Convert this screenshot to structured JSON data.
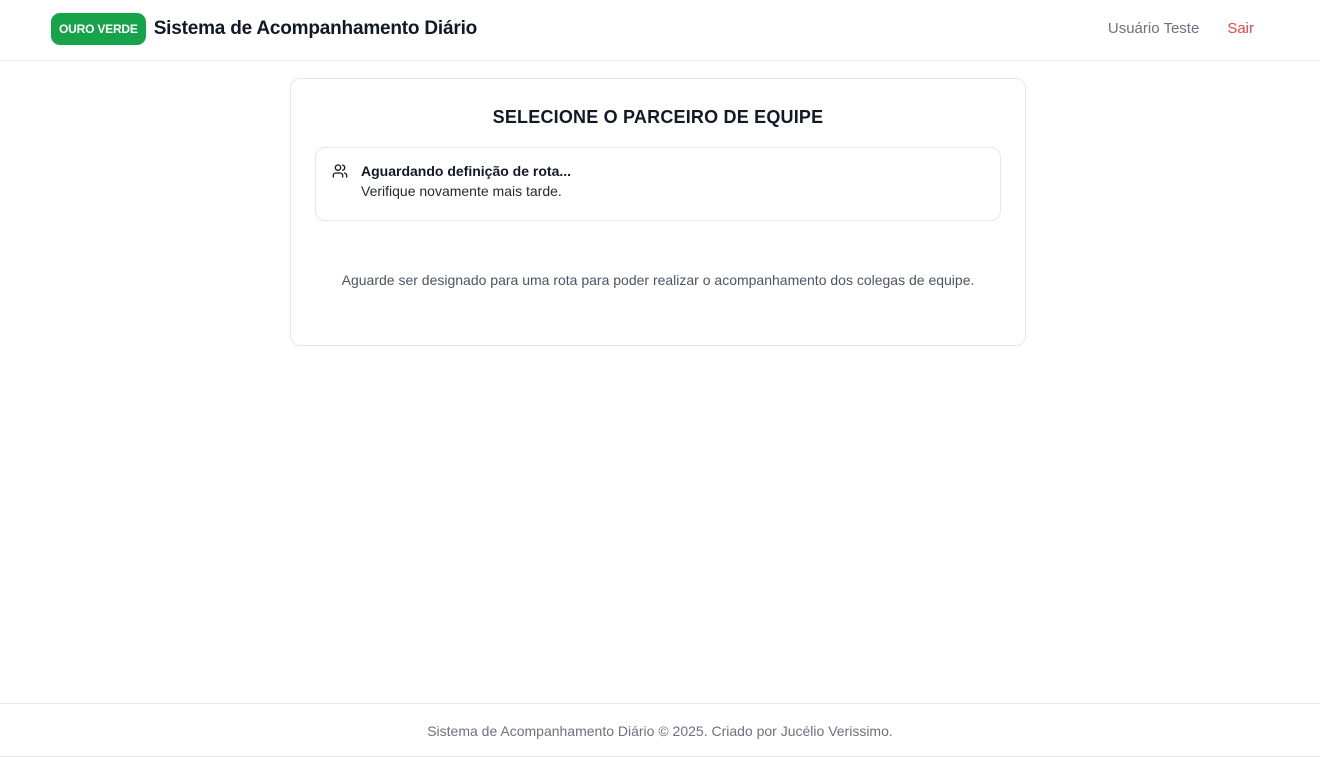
{
  "header": {
    "brand_badge": "OURO VERDE",
    "title": "Sistema de Acompanhamento Diário",
    "user_name": "Usuário Teste",
    "logout_label": "Sair"
  },
  "card": {
    "title": "SELECIONE O PARCEIRO DE EQUIPE",
    "alert": {
      "icon": "users-icon",
      "title": "Aguardando definição de rota...",
      "description": "Verifique novamente mais tarde."
    },
    "note": "Aguarde ser designado para uma rota para poder realizar o acompanhamento dos colegas de equipe."
  },
  "footer": {
    "text": "Sistema de Acompanhamento Diário © 2025. Criado por Jucélio Verissimo."
  },
  "colors": {
    "brand": "#16a34a",
    "logout": "#ef4444",
    "muted": "#6b7280",
    "border": "#e5e7eb"
  }
}
